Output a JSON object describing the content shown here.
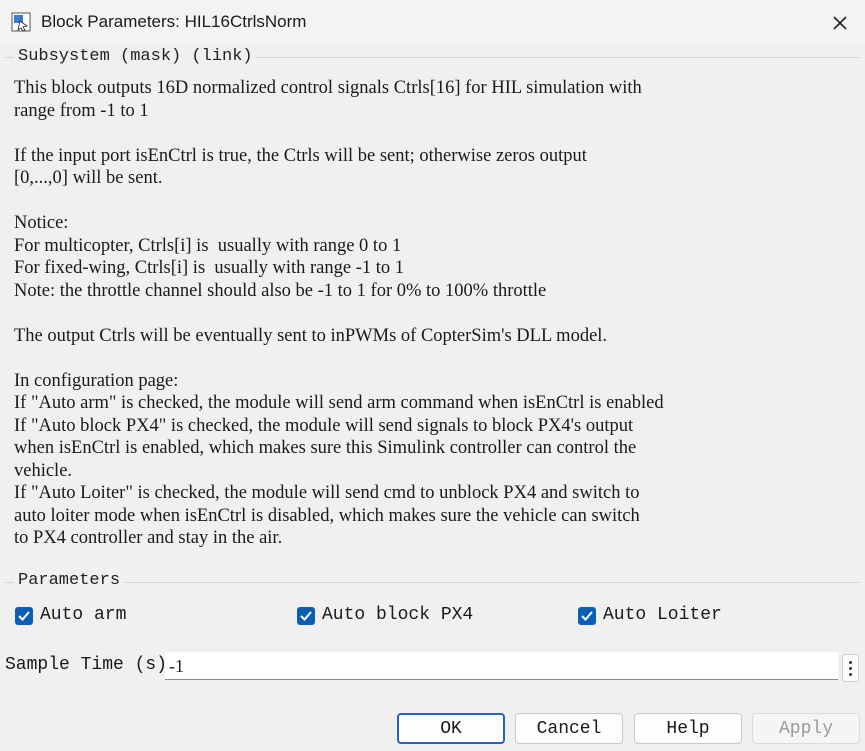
{
  "window": {
    "title": "Block Parameters: HIL16CtrlsNorm",
    "icon": "simulink-block-icon",
    "close_icon": "close-icon"
  },
  "description": {
    "section_label": "Subsystem (mask) (link)",
    "lines": [
      "This block outputs 16D normalized control signals Ctrls[16] for HIL simulation with",
      "range from -1 to 1",
      "",
      "If the input port isEnCtrl is true, the Ctrls will be sent; otherwise zeros output",
      "[0,...,0] will be sent.",
      "",
      "Notice:",
      "For multicopter, Ctrls[i] is  usually with range 0 to 1",
      "For fixed-wing, Ctrls[i] is  usually with range -1 to 1",
      "Note: the throttle channel should also be -1 to 1 for 0% to 100% throttle",
      "",
      "The output Ctrls will be eventually sent to inPWMs of CopterSim's DLL model.",
      "",
      "In configuration page:",
      "If \"Auto arm\" is checked, the module will send arm command when isEnCtrl is enabled",
      "If \"Auto block PX4\" is checked, the module will send signals to block PX4's output",
      "when isEnCtrl is enabled, which makes sure this Simulink controller can control the",
      "vehicle.",
      "If \"Auto Loiter\" is checked, the module will send cmd to unblock PX4 and switch to",
      "auto loiter mode when isEnCtrl is disabled, which makes sure the vehicle can switch",
      "to PX4 controller and stay in the air."
    ]
  },
  "parameters": {
    "section_label": "Parameters",
    "checkboxes": [
      {
        "label": "Auto arm",
        "checked": true
      },
      {
        "label": "Auto block PX4",
        "checked": true
      },
      {
        "label": "Auto Loiter",
        "checked": true
      }
    ],
    "sample_time": {
      "label": "Sample Time (s)",
      "value": "-1"
    }
  },
  "buttons": {
    "ok": "OK",
    "cancel": "Cancel",
    "help": "Help",
    "apply": "Apply"
  },
  "colors": {
    "accent": "#0a5fb5",
    "primary_border": "#2a62b5",
    "background": "#f0f0f0"
  }
}
